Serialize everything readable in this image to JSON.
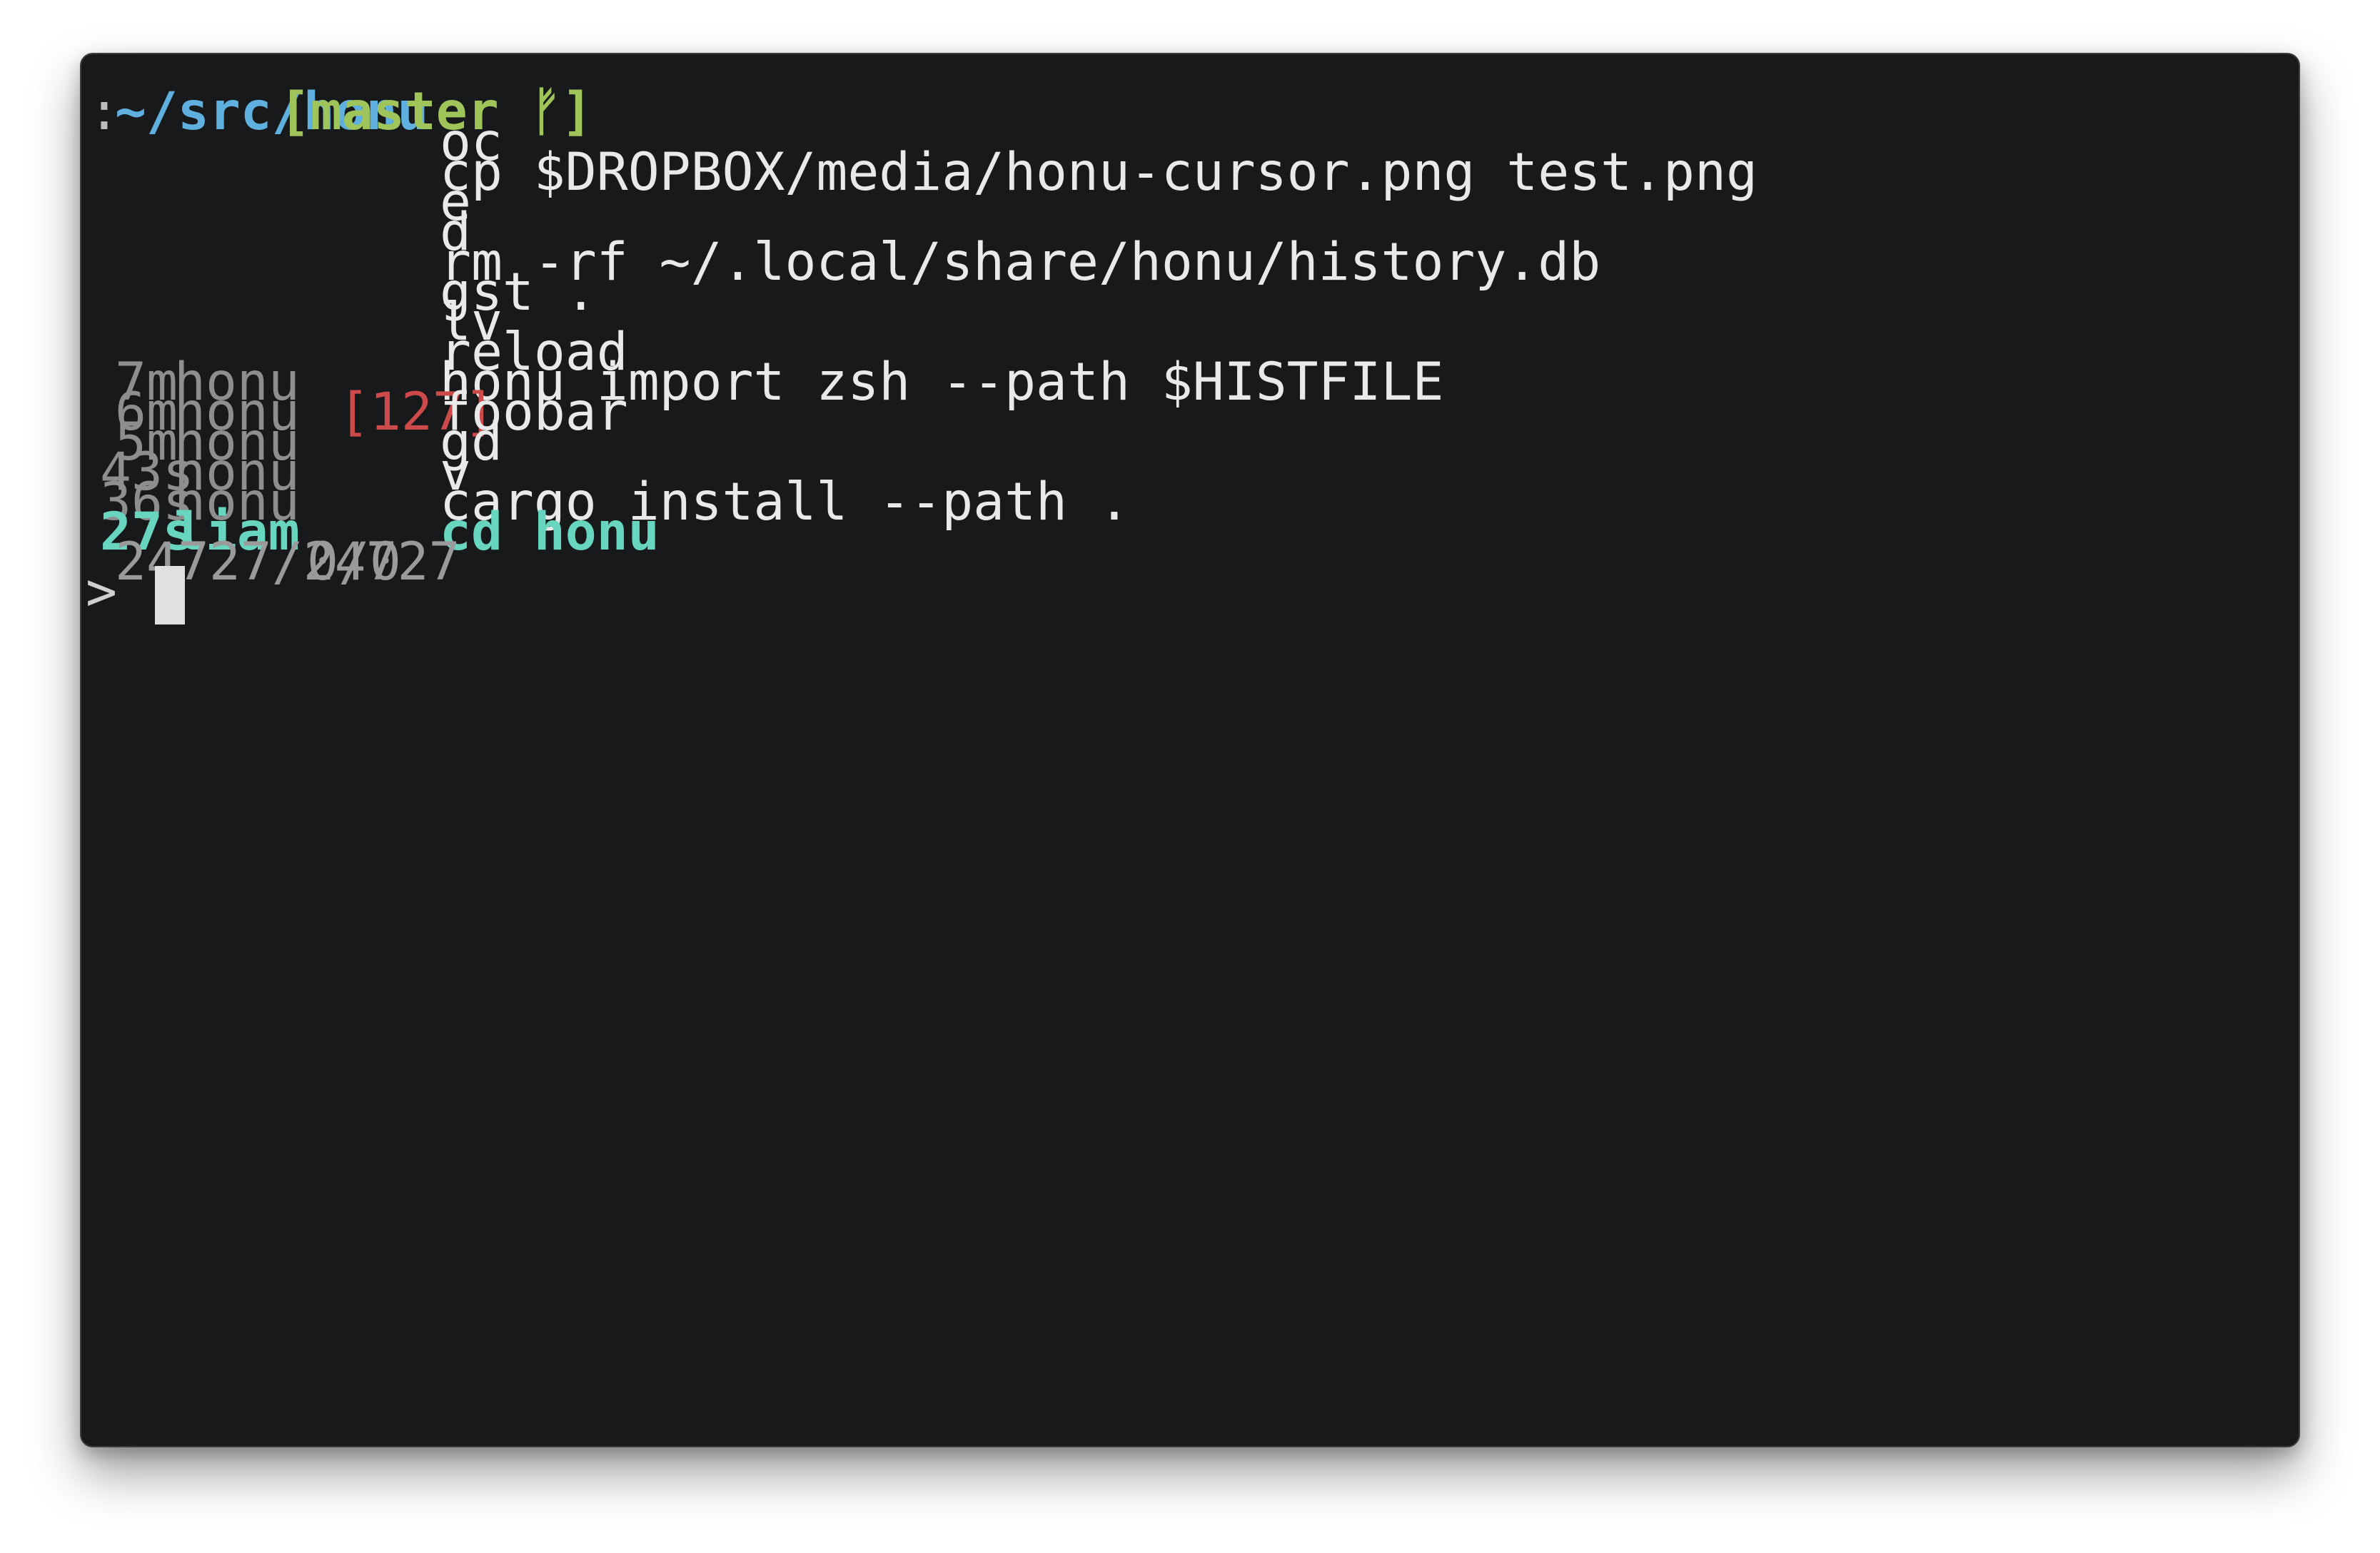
{
  "prompt": {
    "colon": ":",
    "path": "~/src/honu",
    "branch": "[master ᚠ]"
  },
  "history": [
    {
      "age": "",
      "host": "",
      "exit": "",
      "command": "oc",
      "selected": false
    },
    {
      "age": "",
      "host": "",
      "exit": "",
      "command": "cp $DROPBOX/media/honu-cursor.png test.png",
      "selected": false
    },
    {
      "age": "",
      "host": "",
      "exit": "",
      "command": "e",
      "selected": false
    },
    {
      "age": "",
      "host": "",
      "exit": "",
      "command": "d",
      "selected": false
    },
    {
      "age": "",
      "host": "",
      "exit": "",
      "command": "rm -rf ~/.local/share/honu/history.db",
      "selected": false
    },
    {
      "age": "",
      "host": "",
      "exit": "",
      "command": "gst .",
      "selected": false
    },
    {
      "age": "",
      "host": "",
      "exit": "",
      "command": "lv",
      "selected": false
    },
    {
      "age": "",
      "host": "",
      "exit": "",
      "command": "reload",
      "selected": false
    },
    {
      "age": "7m",
      "host": "honu",
      "exit": "",
      "command": "honu import zsh --path $HISTFILE",
      "selected": false
    },
    {
      "age": "6m",
      "host": "honu",
      "exit": "[127]",
      "command": "foobar",
      "selected": false
    },
    {
      "age": "5m",
      "host": "honu",
      "exit": "",
      "command": "gd",
      "selected": false
    },
    {
      "age": "43s",
      "host": "honu",
      "exit": "",
      "command": "v",
      "selected": false
    },
    {
      "age": "36s",
      "host": "honu",
      "exit": "",
      "command": "cargo install --path .",
      "selected": false
    },
    {
      "age": "27s",
      "host": "liam",
      "exit": "",
      "command": "cd honu",
      "selected": true
    }
  ],
  "status": {
    "count": "24727/24727",
    "selection": "0/0"
  },
  "input": {
    "arrow": ">",
    "value": ""
  }
}
